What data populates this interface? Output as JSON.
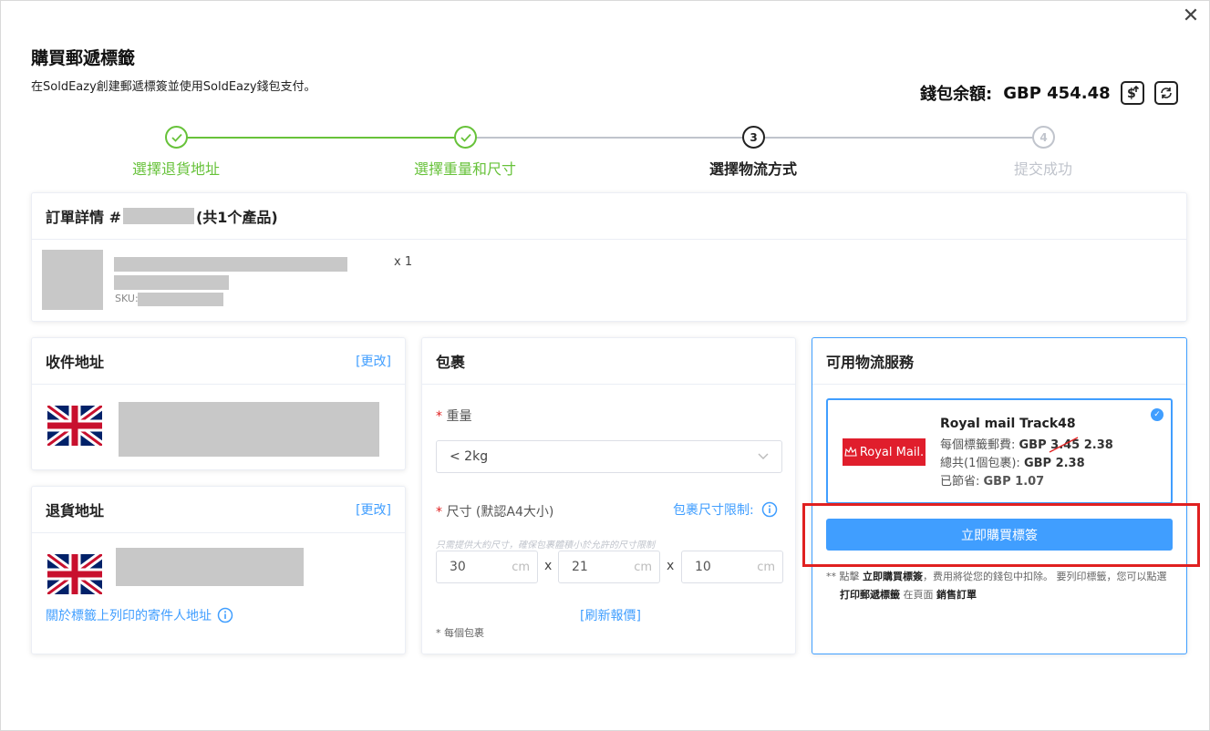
{
  "dialog": {
    "title": "購買郵遞標籤",
    "subtitle": "在SoldEazy創建郵遞標簽並使用SoldEazy錢包支付。",
    "close_glyph": "✕"
  },
  "wallet": {
    "label": "錢包余額:",
    "amount": "GBP 454.48"
  },
  "steps": [
    {
      "number": "1",
      "label": "選擇退貨地址",
      "status": "done"
    },
    {
      "number": "2",
      "label": "選擇重量和尺寸",
      "status": "done"
    },
    {
      "number": "3",
      "label": "選擇物流方式",
      "status": "current"
    },
    {
      "number": "4",
      "label": "提交成功",
      "status": "pending"
    }
  ],
  "order": {
    "title_prefix": "訂單詳情 #",
    "title_suffix": "(共1个產品)",
    "quantity": "x 1",
    "sku_label": "SKU:"
  },
  "recipient": {
    "title": "收件地址",
    "change_link": "[更改]"
  },
  "return_address": {
    "title": "退貨地址",
    "change_link": "[更改]",
    "info_link": "關於標籤上列印的寄件人地址"
  },
  "package": {
    "title": "包裹",
    "weight_label": "重量",
    "weight_value": "< 2kg",
    "size_label": "尺寸 (默認A4大小)",
    "size_limit_link": "包裹尺寸限制:",
    "size_hint": "只需提供大約尺寸，確保包裹體積小於允許的尺寸限制",
    "dims": [
      "30",
      "21",
      "10"
    ],
    "unit": "cm",
    "times": "x",
    "refresh_link": "[刷新報價]",
    "per_package_note": "* 每個包裹"
  },
  "logistics": {
    "title": "可用物流服務",
    "service_name": "Royal mail Track48",
    "logo_text": "Royal Mail.",
    "per_label_prefix": "每個標籤郵費: ",
    "per_label_currency": "GBP ",
    "per_label_old": "3.45",
    "per_label_new": " 2.38",
    "total_prefix": "總共(1個包裹): ",
    "total_value": "GBP 2.38",
    "saved_prefix": "已節省: ",
    "saved_value": "GBP 1.07",
    "buy_button": "立即購買標簽",
    "note_part1": "** 點擊 ",
    "note_bold1": "立即購買標簽",
    "note_part2": "，费用將從您的錢包中扣除。 要列印標籤，您可以點選",
    "note_bold2": "打印郵遞標籤",
    "note_part3": " 在頁面 ",
    "note_bold3": "銷售訂單"
  },
  "colors": {
    "accent": "#409eff",
    "success": "#67c23a",
    "danger": "#e02020",
    "royal_mail_red": "#e01e2c"
  }
}
